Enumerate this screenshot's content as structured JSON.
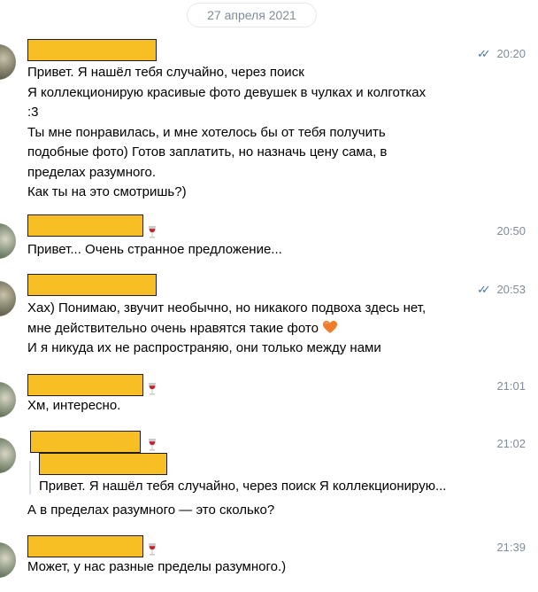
{
  "date_divider": "27 апреля 2021",
  "colors": {
    "name_redaction": "#f8bf24",
    "time": "#818c99",
    "read_check": "#4a76a8",
    "reply_bar": "#dbe1e8"
  },
  "messages": [
    {
      "time": "20:20",
      "read": true,
      "lines": [
        "Привет. Я нашёл тебя случайно, через поиск",
        "Я коллекционирую красивые фото девушек в чулках и колготках",
        ":3",
        "Ты мне понравилась, и мне хотелось бы от тебя получить",
        "подобные фото) Готов заплатить, но назначь цену сама, в",
        "пределах разумного.",
        "Как ты на это смотришь?)"
      ]
    },
    {
      "time": "20:50",
      "lines": [
        "Привет... Очень странное предложение..."
      ]
    },
    {
      "time": "20:53",
      "read": true,
      "lines": [
        "Хах) Понимаю, звучит необычно, но никакого подвоха здесь нет,",
        "мне действительно очень нравятся такие фото",
        "И я никуда их не распространяю, они только между нами"
      ]
    },
    {
      "time": "21:01",
      "lines": [
        "Хм, интересно."
      ]
    },
    {
      "time": "21:02",
      "reply_quote": "Привет. Я нашёл тебя случайно, через поиск Я коллекционирую...",
      "lines": [
        "А в пределах разумного — это сколько?"
      ]
    },
    {
      "time": "21:39",
      "lines": [
        "Может, у нас разные пределы разумного.)"
      ]
    }
  ],
  "icons": {
    "read": "double-check-icon",
    "status": "wine-glass-icon",
    "emoji": "orange-heart-icon"
  }
}
